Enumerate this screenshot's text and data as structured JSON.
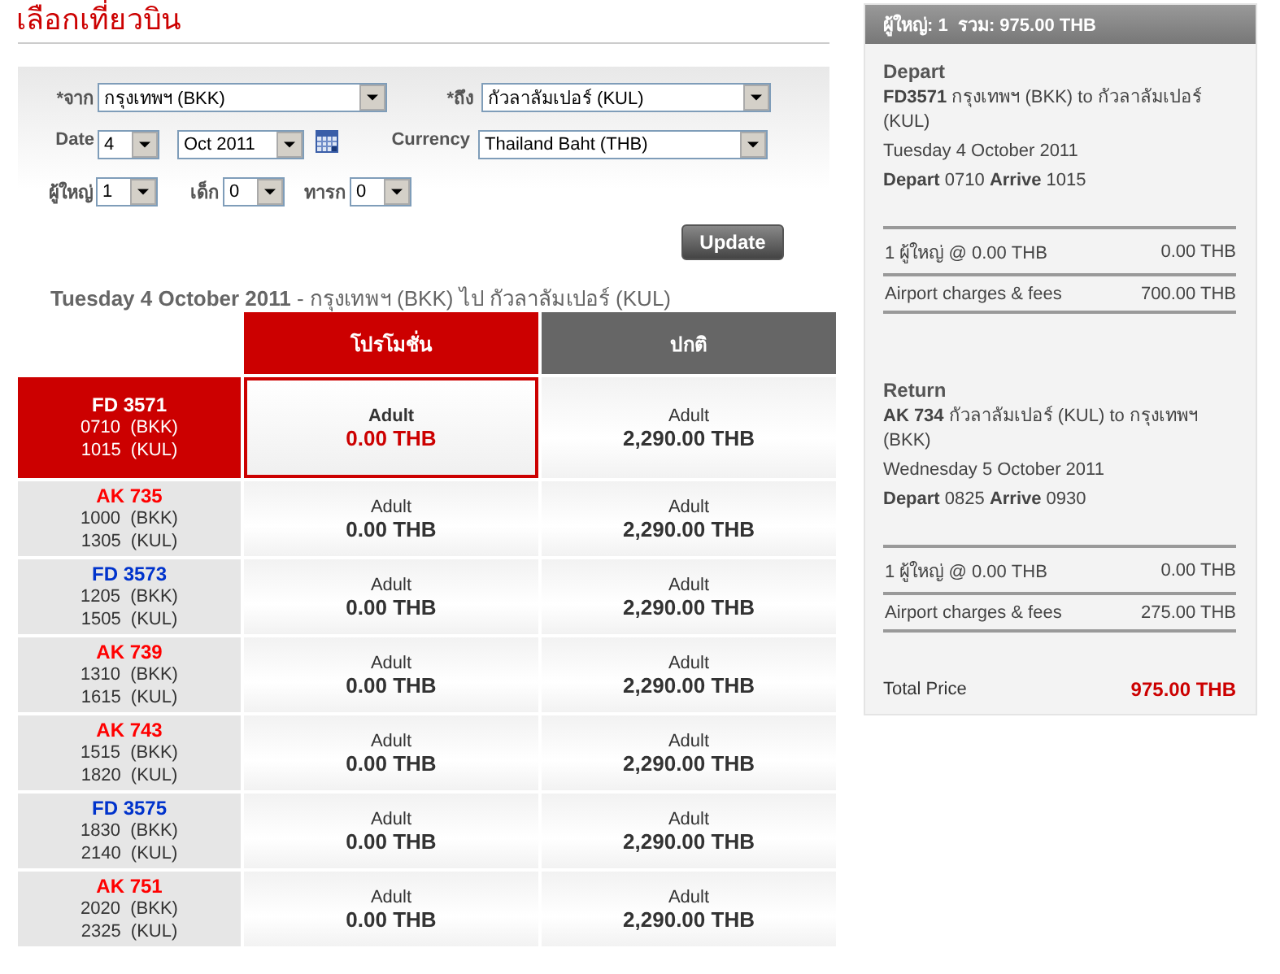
{
  "page_title": "เลือกเที่ยวบิน",
  "search_form": {
    "from": {
      "label": "*จาก",
      "value": "กรุงเทพฯ (BKK)"
    },
    "to": {
      "label": "*ถึง",
      "value": "กัวลาลัมเปอร์ (KUL)"
    },
    "date": {
      "label": "Date",
      "day": "4",
      "month": "Oct 2011"
    },
    "currency": {
      "label": "Currency",
      "value": "Thailand Baht (THB)"
    },
    "passengers": [
      {
        "label": "ผู้ใหญ่",
        "value": "1"
      },
      {
        "label": "เด็ก",
        "value": "0"
      },
      {
        "label": "ทารก",
        "value": "0"
      }
    ],
    "update_button": "Update"
  },
  "route_heading": "**Tuesday 4 October 2011** - กรุงเทพฯ (BKK)  ไป  กัวลาลัมเปอร์ (KUL)",
  "fare_table": {
    "columns": [
      {
        "label": "โปรโมชั่น",
        "color": "#cc0000"
      },
      {
        "label": "ปกติ",
        "color": "#666666"
      }
    ],
    "rows": [
      {
        "flight": "FD 3571",
        "depart": "0710  (BKK)",
        "arrive": "1015  (KUL)",
        "color": "#ffffff",
        "selected": true,
        "fares": [
          {
            "label": "Adult",
            "price": "0.00 THB",
            "selected": true
          },
          {
            "label": "Adult",
            "price": "2,290.00 THB",
            "selected": false
          }
        ]
      },
      {
        "flight": "AK 735",
        "depart": "1000  (BKK)",
        "arrive": "1305  (KUL)",
        "color": "#ff0000",
        "selected": false,
        "fares": [
          {
            "label": "Adult",
            "price": "0.00 THB",
            "selected": false
          },
          {
            "label": "Adult",
            "price": "2,290.00 THB",
            "selected": false
          }
        ]
      },
      {
        "flight": "FD 3573",
        "depart": "1205  (BKK)",
        "arrive": "1505  (KUL)",
        "color": "#0033cc",
        "selected": false,
        "fares": [
          {
            "label": "Adult",
            "price": "0.00 THB",
            "selected": false
          },
          {
            "label": "Adult",
            "price": "2,290.00 THB",
            "selected": false
          }
        ]
      },
      {
        "flight": "AK 739",
        "depart": "1310  (BKK)",
        "arrive": "1615  (KUL)",
        "color": "#ff0000",
        "selected": false,
        "fares": [
          {
            "label": "Adult",
            "price": "0.00 THB",
            "selected": false
          },
          {
            "label": "Adult",
            "price": "2,290.00 THB",
            "selected": false
          }
        ]
      },
      {
        "flight": "AK 743",
        "depart": "1515  (BKK)",
        "arrive": "1820  (KUL)",
        "color": "#ff0000",
        "selected": false,
        "fares": [
          {
            "label": "Adult",
            "price": "0.00 THB",
            "selected": false
          },
          {
            "label": "Adult",
            "price": "2,290.00 THB",
            "selected": false
          }
        ]
      },
      {
        "flight": "FD 3575",
        "depart": "1830  (BKK)",
        "arrive": "2140  (KUL)",
        "color": "#0033cc",
        "selected": false,
        "fares": [
          {
            "label": "Adult",
            "price": "0.00 THB",
            "selected": false
          },
          {
            "label": "Adult",
            "price": "2,290.00 THB",
            "selected": false
          }
        ]
      },
      {
        "flight": "AK 751",
        "depart": "2020  (BKK)",
        "arrive": "2325  (KUL)",
        "color": "#ff0000",
        "selected": false,
        "fares": [
          {
            "label": "Adult",
            "price": "0.00 THB",
            "selected": false
          },
          {
            "label": "Adult",
            "price": "2,290.00 THB",
            "selected": false
          }
        ]
      }
    ]
  },
  "summary": {
    "header": "ผู้ใหญ่: 1  รวม: 975.00 THB",
    "sections": [
      {
        "heading": "Depart",
        "flight": "**FD3571** กรุงเทพฯ (BKK) to กัวลาลัมเปอร์ (KUL)",
        "date": "Tuesday 4 October 2011",
        "times": "**Depart** 0710 **Arrive** 1015",
        "lines": [
          {
            "label": "1 ผู้ใหญ่ @ 0.00 THB",
            "amount": "0.00 THB"
          },
          {
            "label": "Airport charges & fees",
            "amount": "700.00 THB"
          }
        ]
      },
      {
        "heading": "Return",
        "flight": "**AK 734** กัวลาลัมเปอร์ (KUL) to กรุงเทพฯ (BKK)",
        "date": "Wednesday 5 October 2011",
        "times": "**Depart** 0825 **Arrive** 0930",
        "lines": [
          {
            "label": "1 ผู้ใหญ่ @ 0.00 THB",
            "amount": "0.00 THB"
          },
          {
            "label": "Airport charges & fees",
            "amount": "275.00 THB"
          }
        ]
      }
    ],
    "total_label": "Total Price",
    "total_amount": "975.00 THB"
  }
}
